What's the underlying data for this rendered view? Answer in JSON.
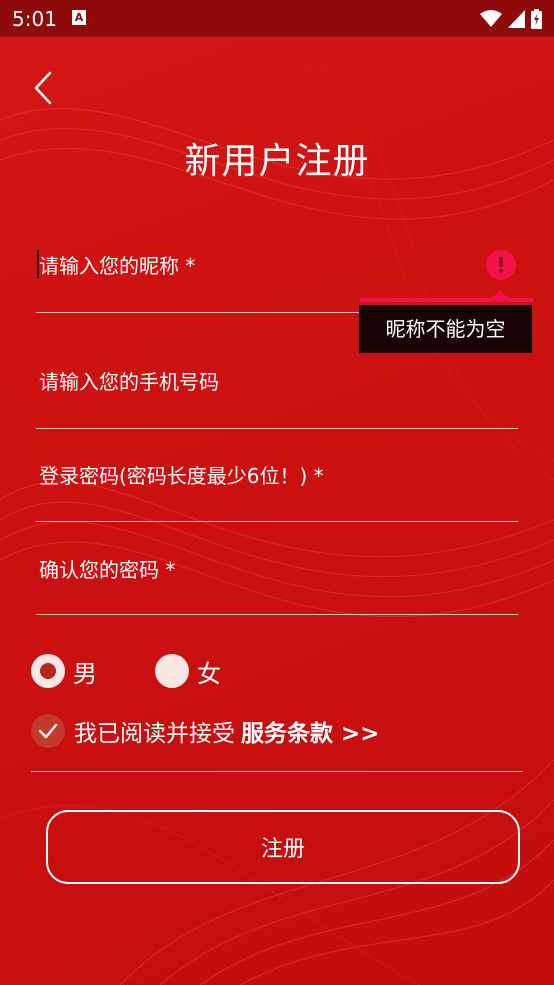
{
  "status_bar": {
    "time": "5:01",
    "notification_icon_letter": "A"
  },
  "header": {
    "title": "新用户注册"
  },
  "form": {
    "nickname": {
      "placeholder": "请输入您的昵称 *",
      "value": "",
      "error_message": "昵称不能为空"
    },
    "phone": {
      "placeholder": "请输入您的手机号码",
      "value": ""
    },
    "password": {
      "placeholder": "登录密码(密码长度最少6位！) *",
      "value": ""
    },
    "confirm_password": {
      "placeholder": "确认您的密码 *",
      "value": ""
    }
  },
  "gender": {
    "options": [
      {
        "label": "男",
        "selected": true
      },
      {
        "label": "女",
        "selected": false
      }
    ]
  },
  "agreement": {
    "checked": true,
    "text": "我已阅读并接受",
    "terms_link": "服务条款 >>"
  },
  "actions": {
    "register_label": "注册"
  },
  "colors": {
    "background": "#cc1111",
    "status_bar": "#8f0a0a",
    "error_accent": "#f2114b",
    "tooltip_bg": "#190505"
  }
}
